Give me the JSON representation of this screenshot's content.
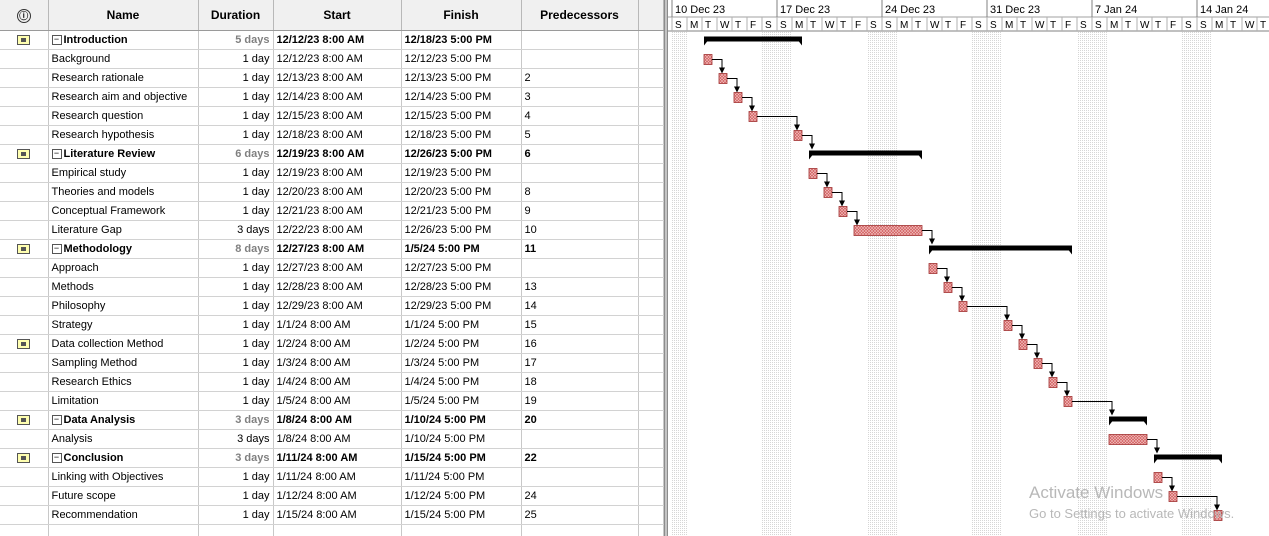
{
  "columns": {
    "indicator": "ⓘ",
    "name": "Name",
    "duration": "Duration",
    "start": "Start",
    "finish": "Finish",
    "predecessors": "Predecessors"
  },
  "tasks": [
    {
      "id": 1,
      "name": "Introduction",
      "duration": "5 days",
      "start": "12/12/23 8:00 AM",
      "finish": "12/18/23 5:00 PM",
      "predecessors": "",
      "summary": true,
      "s": "2023-12-12",
      "e": "2023-12-18"
    },
    {
      "id": 2,
      "name": "Background",
      "duration": "1 day",
      "start": "12/12/23 8:00 AM",
      "finish": "12/12/23 5:00 PM",
      "predecessors": "",
      "summary": false,
      "s": "2023-12-12",
      "e": "2023-12-12"
    },
    {
      "id": 3,
      "name": "Research rationale",
      "duration": "1 day",
      "start": "12/13/23 8:00 AM",
      "finish": "12/13/23 5:00 PM",
      "predecessors": "2",
      "summary": false,
      "s": "2023-12-13",
      "e": "2023-12-13"
    },
    {
      "id": 4,
      "name": "Research aim and objective",
      "duration": "1 day",
      "start": "12/14/23 8:00 AM",
      "finish": "12/14/23 5:00 PM",
      "predecessors": "3",
      "summary": false,
      "s": "2023-12-14",
      "e": "2023-12-14"
    },
    {
      "id": 5,
      "name": "Research question",
      "duration": "1 day",
      "start": "12/15/23 8:00 AM",
      "finish": "12/15/23 5:00 PM",
      "predecessors": "4",
      "summary": false,
      "s": "2023-12-15",
      "e": "2023-12-15"
    },
    {
      "id": 6,
      "name": "Research hypothesis",
      "duration": "1 day",
      "start": "12/18/23 8:00 AM",
      "finish": "12/18/23 5:00 PM",
      "predecessors": "5",
      "summary": false,
      "s": "2023-12-18",
      "e": "2023-12-18"
    },
    {
      "id": 7,
      "name": "Literature Review",
      "duration": "6 days",
      "start": "12/19/23 8:00 AM",
      "finish": "12/26/23 5:00 PM",
      "predecessors": "6",
      "summary": true,
      "s": "2023-12-19",
      "e": "2023-12-26"
    },
    {
      "id": 8,
      "name": "Empirical study",
      "duration": "1 day",
      "start": "12/19/23 8:00 AM",
      "finish": "12/19/23 5:00 PM",
      "predecessors": "",
      "summary": false,
      "s": "2023-12-19",
      "e": "2023-12-19"
    },
    {
      "id": 9,
      "name": "Theories and models",
      "duration": "1 day",
      "start": "12/20/23 8:00 AM",
      "finish": "12/20/23 5:00 PM",
      "predecessors": "8",
      "summary": false,
      "s": "2023-12-20",
      "e": "2023-12-20"
    },
    {
      "id": 10,
      "name": "Conceptual Framework",
      "duration": "1 day",
      "start": "12/21/23 8:00 AM",
      "finish": "12/21/23 5:00 PM",
      "predecessors": "9",
      "summary": false,
      "s": "2023-12-21",
      "e": "2023-12-21"
    },
    {
      "id": 11,
      "name": "Literature Gap",
      "duration": "3 days",
      "start": "12/22/23 8:00 AM",
      "finish": "12/26/23 5:00 PM",
      "predecessors": "10",
      "summary": false,
      "s": "2023-12-22",
      "e": "2023-12-26"
    },
    {
      "id": 12,
      "name": "Methodology",
      "duration": "8 days",
      "start": "12/27/23 8:00 AM",
      "finish": "1/5/24 5:00 PM",
      "predecessors": "11",
      "summary": true,
      "s": "2023-12-27",
      "e": "2024-01-05"
    },
    {
      "id": 13,
      "name": "Approach",
      "duration": "1 day",
      "start": "12/27/23 8:00 AM",
      "finish": "12/27/23 5:00 PM",
      "predecessors": "",
      "summary": false,
      "s": "2023-12-27",
      "e": "2023-12-27"
    },
    {
      "id": 14,
      "name": "Methods",
      "duration": "1 day",
      "start": "12/28/23 8:00 AM",
      "finish": "12/28/23 5:00 PM",
      "predecessors": "13",
      "summary": false,
      "s": "2023-12-28",
      "e": "2023-12-28"
    },
    {
      "id": 15,
      "name": "Philosophy",
      "duration": "1 day",
      "start": "12/29/23 8:00 AM",
      "finish": "12/29/23 5:00 PM",
      "predecessors": "14",
      "summary": false,
      "s": "2023-12-29",
      "e": "2023-12-29"
    },
    {
      "id": 16,
      "name": "Strategy",
      "duration": "1 day",
      "start": "1/1/24 8:00 AM",
      "finish": "1/1/24 5:00 PM",
      "predecessors": "15",
      "summary": false,
      "s": "2024-01-01",
      "e": "2024-01-01"
    },
    {
      "id": 17,
      "name": "Data collection Method",
      "duration": "1 day",
      "start": "1/2/24 8:00 AM",
      "finish": "1/2/24 5:00 PM",
      "predecessors": "16",
      "summary": false,
      "s": "2024-01-02",
      "e": "2024-01-02"
    },
    {
      "id": 18,
      "name": "Sampling Method",
      "duration": "1 day",
      "start": "1/3/24 8:00 AM",
      "finish": "1/3/24 5:00 PM",
      "predecessors": "17",
      "summary": false,
      "s": "2024-01-03",
      "e": "2024-01-03"
    },
    {
      "id": 19,
      "name": "Research Ethics",
      "duration": "1 day",
      "start": "1/4/24 8:00 AM",
      "finish": "1/4/24 5:00 PM",
      "predecessors": "18",
      "summary": false,
      "s": "2024-01-04",
      "e": "2024-01-04"
    },
    {
      "id": 20,
      "name": "Limitation",
      "duration": "1 day",
      "start": "1/5/24 8:00 AM",
      "finish": "1/5/24 5:00 PM",
      "predecessors": "19",
      "summary": false,
      "s": "2024-01-05",
      "e": "2024-01-05"
    },
    {
      "id": 21,
      "name": "Data Analysis",
      "duration": "3 days",
      "start": "1/8/24 8:00 AM",
      "finish": "1/10/24 5:00 PM",
      "predecessors": "20",
      "summary": true,
      "s": "2024-01-08",
      "e": "2024-01-10"
    },
    {
      "id": 22,
      "name": "Analysis",
      "duration": "3 days",
      "start": "1/8/24 8:00 AM",
      "finish": "1/10/24 5:00 PM",
      "predecessors": "",
      "summary": false,
      "s": "2024-01-08",
      "e": "2024-01-10"
    },
    {
      "id": 23,
      "name": "Conclusion",
      "duration": "3 days",
      "start": "1/11/24 8:00 AM",
      "finish": "1/15/24 5:00 PM",
      "predecessors": "22",
      "summary": true,
      "s": "2024-01-11",
      "e": "2024-01-15"
    },
    {
      "id": 24,
      "name": "Linking with Objectives",
      "duration": "1 day",
      "start": "1/11/24 8:00 AM",
      "finish": "1/11/24 5:00 PM",
      "predecessors": "",
      "summary": false,
      "s": "2024-01-11",
      "e": "2024-01-11"
    },
    {
      "id": 25,
      "name": "Future scope",
      "duration": "1 day",
      "start": "1/12/24 8:00 AM",
      "finish": "1/12/24 5:00 PM",
      "predecessors": "24",
      "summary": false,
      "s": "2024-01-12",
      "e": "2024-01-12"
    },
    {
      "id": 26,
      "name": "Recommendation",
      "duration": "1 day",
      "start": "1/15/24 8:00 AM",
      "finish": "1/15/24 5:00 PM",
      "predecessors": "25",
      "summary": false,
      "s": "2024-01-15",
      "e": "2024-01-15"
    }
  ],
  "timescale": {
    "weeks": [
      "10 Dec 23",
      "17 Dec 23",
      "24 Dec 23",
      "31 Dec 23",
      "7 Jan 24",
      "14 Jan 24"
    ],
    "day_letters": [
      "S",
      "M",
      "T",
      "W",
      "T",
      "F",
      "S"
    ],
    "first_day": "2023-12-10"
  },
  "icons": {
    "note": "note-icon",
    "collapse": "minus-toggle-icon"
  },
  "colors": {
    "task_bar": "#d06060",
    "summary_bar": "#000000",
    "link": "#000000",
    "grid_header": "#f0f0f0"
  },
  "watermark": {
    "line1": "Activate Windows",
    "line2": "Go to Settings to activate Windows."
  }
}
